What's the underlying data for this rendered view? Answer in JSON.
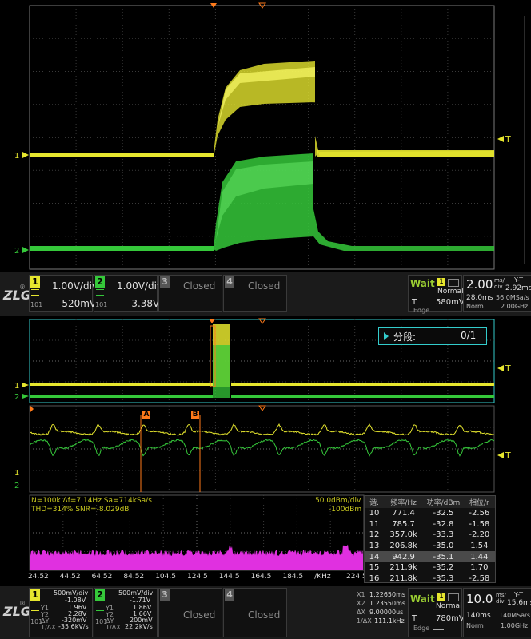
{
  "colors": {
    "ch1": "#e6e62e",
    "ch2": "#35c83a",
    "fft": "#e030e0",
    "accent": "#33cccc",
    "marker": "#ff7a1a",
    "wait": "#9acd32"
  },
  "top_scope": {
    "ch1_marker": "1",
    "ch2_marker": "2",
    "trigger_label": "T"
  },
  "status_bar_top": {
    "logo": "ZLG",
    "channels": [
      {
        "num": "1",
        "scale": "1.00V/div",
        "offset": "-520mV",
        "color": "#e6e62e"
      },
      {
        "num": "2",
        "scale": "1.00V/div",
        "offset": "-3.38V",
        "color": "#35c83a"
      },
      {
        "num": "3",
        "label": "Closed",
        "offset": "--"
      },
      {
        "num": "4",
        "label": "Closed",
        "offset": "--"
      }
    ],
    "trigger": {
      "status": "Wait",
      "source": "1",
      "mode": "Normal",
      "type_label": "T",
      "level": "580mV",
      "edge": "Edge"
    },
    "timebase": {
      "scale": "2.00",
      "unit_top": "ms/",
      "unit_bottom": "div",
      "yt_label": "Y-T",
      "delay": "2.92ms",
      "record": "28.0ms",
      "rate": "56.0MSa/s",
      "acq": "Norm",
      "bw": "2.00GHz"
    }
  },
  "overview": {
    "segment_label": "分段:",
    "segment_value": "0/1",
    "ch1_marker": "1",
    "ch2_marker": "2",
    "trigger_label": "T"
  },
  "zoom": {
    "cursor_a": "A",
    "cursor_b": "B",
    "ch1_marker": "1",
    "ch2_marker": "2",
    "trigger_label": "T"
  },
  "fft": {
    "info_line1": "N=100k  Δf=7.14Hz  Sa=714kSa/s",
    "info_line2": "THD=314%  SNR=-8.029dB",
    "ref_level": "50.0dBm/div",
    "ref_offset": "-100dBm",
    "x_ticks": [
      "24.52",
      "44.52",
      "64.52",
      "84.52",
      "104.5",
      "124.5",
      "144.5",
      "164.5",
      "184.5",
      "/KHz",
      "224.5"
    ],
    "table_headers": [
      "谐.",
      "频率/Hz",
      "功率/dBm",
      "相位/r"
    ],
    "rows": [
      [
        "10",
        "771.4",
        "-32.5",
        "-2.56"
      ],
      [
        "11",
        "785.7",
        "-32.8",
        "-1.58"
      ],
      [
        "12",
        "357.0k",
        "-33.3",
        "-2.20"
      ],
      [
        "13",
        "206.8k",
        "-35.0",
        "1.54"
      ],
      [
        "14",
        "942.9",
        "-35.1",
        "1.44"
      ],
      [
        "15",
        "211.9k",
        "-35.2",
        "1.70"
      ],
      [
        "16",
        "211.8k",
        "-35.3",
        "-2.58"
      ]
    ],
    "selected_row": 4
  },
  "status_bar_bottom": {
    "logo": "ZLG",
    "ch1": {
      "num": "1",
      "scale": "500mV/div",
      "offset": "-1.08V",
      "y1": "Y1",
      "y1v": "1.96V",
      "y2": "Y2",
      "y2v": "2.28V",
      "dy": "ΔY",
      "dyv": "-320mV",
      "fx": "1/ΔX",
      "fxv": "-35.6kV/s"
    },
    "ch2": {
      "num": "2",
      "scale": "500mV/div",
      "offset": "-1.71V",
      "y1": "Y1",
      "y1v": "1.86V",
      "y2": "Y2",
      "y2v": "1.66V",
      "dy": "ΔY",
      "dyv": "200mV",
      "fx": "1/ΔX",
      "fxv": "22.2kV/s"
    },
    "ch3": {
      "num": "3",
      "label": "Closed"
    },
    "ch4": {
      "num": "4",
      "label": "Closed"
    },
    "cursor": {
      "x1": "X1",
      "x1v": "1.22650ms",
      "x2": "X2",
      "x2v": "1.23550ms",
      "dx": "ΔX",
      "dxv": "9.00000us",
      "fdx": "1/ΔX",
      "fdxv": "111.1kHz"
    },
    "trigger": {
      "status": "Wait",
      "source": "1",
      "mode": "Normal",
      "type_label": "T",
      "level": "780mV",
      "edge": "Edge"
    },
    "timebase": {
      "scale": "10.0",
      "unit_top": "ms/",
      "unit_bottom": "div",
      "yt_label": "Y-T",
      "delay": "15.6ms",
      "record": "140ms",
      "rate": "140MSa/s",
      "acq": "Norm",
      "bw": "1.00GHz"
    }
  }
}
